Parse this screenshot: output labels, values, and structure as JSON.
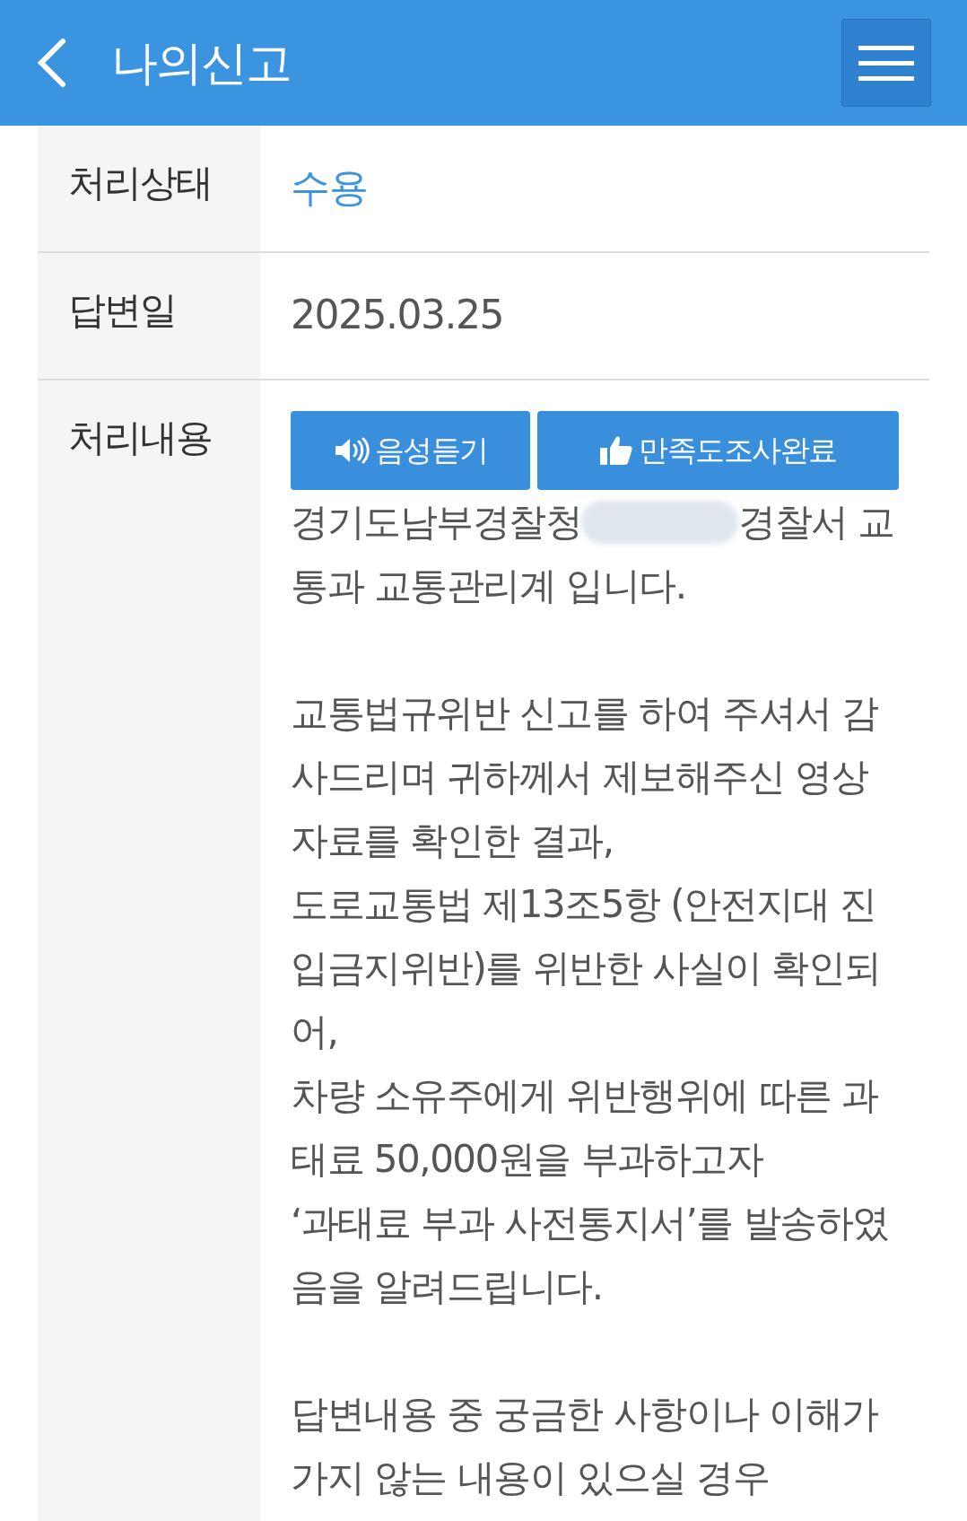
{
  "header": {
    "title": "나의신고"
  },
  "rows": [
    {
      "kind": "status",
      "label": "처리상태",
      "value": "수용"
    },
    {
      "kind": "text",
      "label": "답변일",
      "value": "2025.03.25"
    },
    {
      "kind": "content",
      "label": "처리내용"
    }
  ],
  "content": {
    "buttons": [
      {
        "kind": "listen",
        "label": "음성듣기"
      },
      {
        "kind": "survey",
        "label": "만족도조사완료"
      }
    ],
    "blocks": [
      {
        "kind": "redacted",
        "before": "경기도남부경찰청",
        "after": "경찰서 교",
        "lines": [
          "통과 교통관리계 입니다."
        ]
      },
      {
        "kind": "text",
        "lines": [
          "교통법규위반 신고를 하여 주셔서 감",
          "사드리며 귀하께서 제보해주신 영상",
          "자료를 확인한 결과,",
          "도로교통법 제13조5항 (안전지대 진",
          "입금지위반)를 위반한 사실이 확인되",
          "어,",
          "차량 소유주에게 위반행위에 따른 과",
          "태료 50,000원을 부과하고자",
          "‘과태료 부과 사전통지서’를 발송하였",
          "음을 알려드립니다."
        ]
      },
      {
        "kind": "text",
        "lines": [
          "답변내용 중 궁금한 사항이나 이해가",
          "가지 않는 내용이 있으실 경우"
        ]
      }
    ]
  }
}
